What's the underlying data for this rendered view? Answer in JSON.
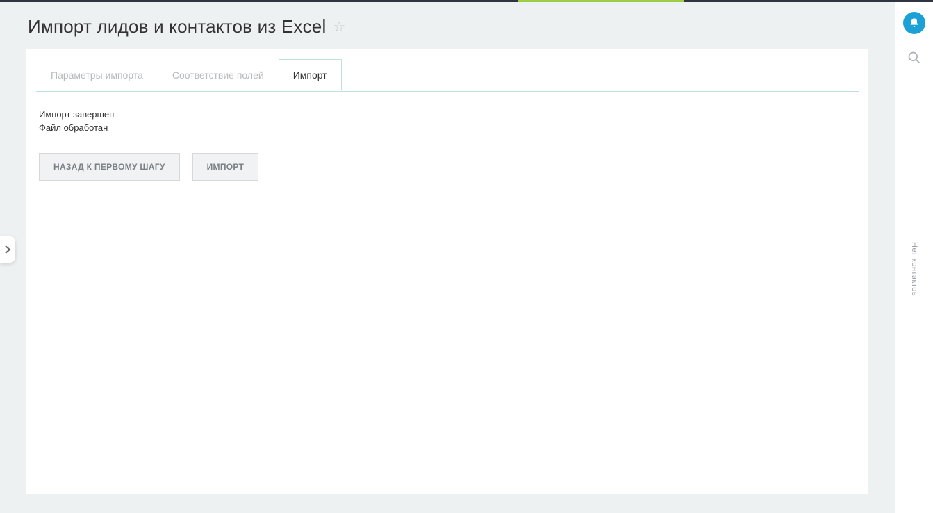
{
  "header": {
    "title": "Импорт лидов и контактов из Excel"
  },
  "tabs": {
    "items": [
      {
        "label": "Параметры импорта",
        "active": false
      },
      {
        "label": "Соответствие полей",
        "active": false
      },
      {
        "label": "Импорт",
        "active": true
      }
    ]
  },
  "status": {
    "line1": "Импорт завершен",
    "line2": "Файл обработан"
  },
  "buttons": {
    "back": "НАЗАД К ПЕРВОМУ ШАГУ",
    "import": "ИМПОРТ"
  },
  "rail": {
    "noContacts": "Нет контактов"
  }
}
